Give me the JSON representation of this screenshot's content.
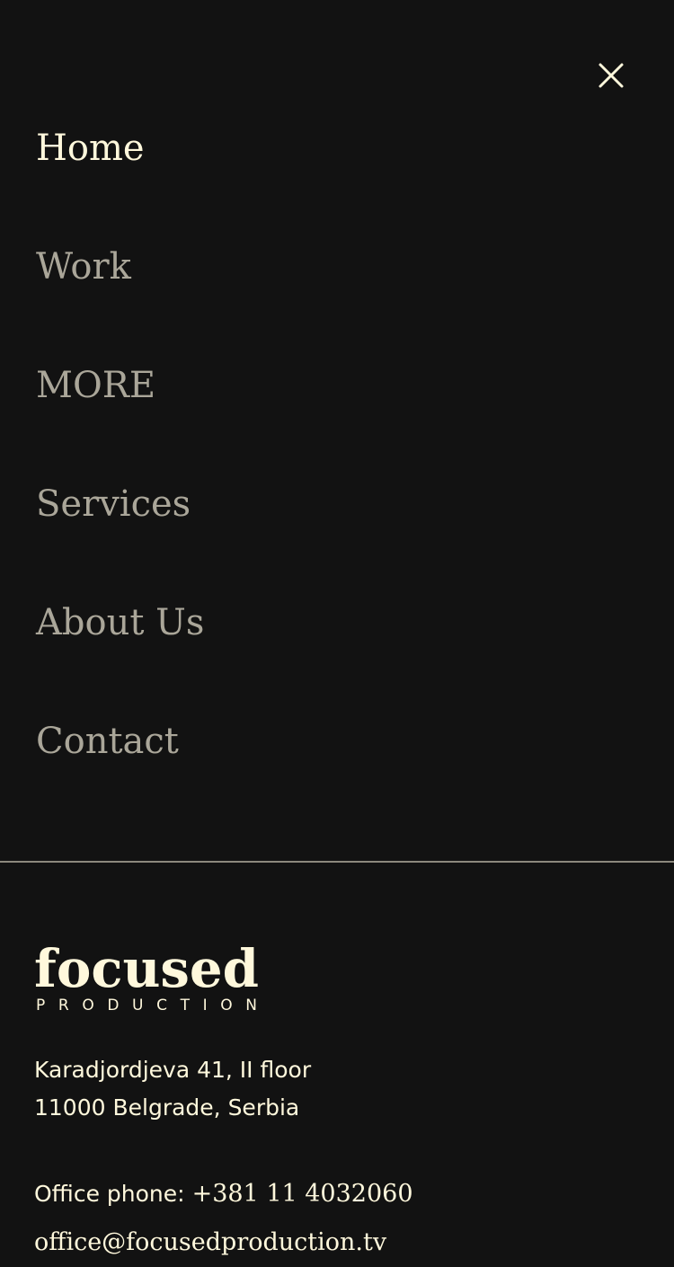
{
  "menu": {
    "close_icon": "close-icon",
    "items": [
      {
        "label": "Home",
        "active": true
      },
      {
        "label": "Work",
        "active": false
      },
      {
        "label": "MORE",
        "active": false
      },
      {
        "label": "Services",
        "active": false
      },
      {
        "label": "About Us",
        "active": false
      },
      {
        "label": "Contact",
        "active": false
      }
    ]
  },
  "footer": {
    "logo": {
      "wordmark": "focused",
      "tagline": "PRODUCTION"
    },
    "address_line1": "Karadjordjeva 41, II floor",
    "address_line2": "11000 Belgrade, Serbia",
    "phone_label": "Office phone:",
    "phone_number": "+381 11 4032060",
    "email": "office@focusedproduction.tv"
  },
  "colors": {
    "background": "#121212",
    "text_active": "#fff8dc",
    "text_muted": "#aaa699",
    "divider": "#8c887d"
  }
}
